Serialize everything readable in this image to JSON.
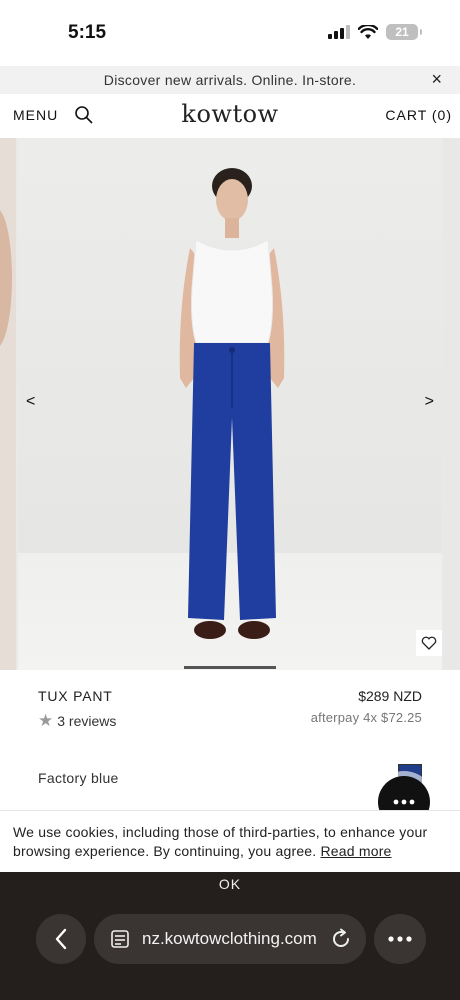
{
  "status_bar": {
    "time": "5:15",
    "battery": "21"
  },
  "announcement": {
    "text": "Discover new arrivals. Online. In-store.",
    "close_label": "×"
  },
  "header": {
    "menu_label": "MENU",
    "logo": "kowtow",
    "cart_label": "CART (0)"
  },
  "carousel": {
    "prev_label": "<",
    "next_label": ">"
  },
  "product": {
    "name": "TUX PANT",
    "price": "$289 NZD",
    "reviews": "3 reviews",
    "afterpay": "afterpay 4x $72.25",
    "color_name": "Factory blue",
    "swatch_color": "#1f3d8a"
  },
  "cookie": {
    "text": "We use cookies, including those of third-parties, to enhance your browsing experience. By continuing, you agree.",
    "link_label": "Read more",
    "ok_label": "OK"
  },
  "browser": {
    "url": "nz.kowtowclothing.com"
  },
  "icons": {
    "search": "search-icon",
    "close": "close-icon",
    "heart": "heart-icon",
    "star": "star-icon",
    "chat": "chat-icon",
    "back": "back-icon",
    "tabs": "tabs-icon",
    "reload": "reload-icon",
    "more": "more-icon"
  }
}
